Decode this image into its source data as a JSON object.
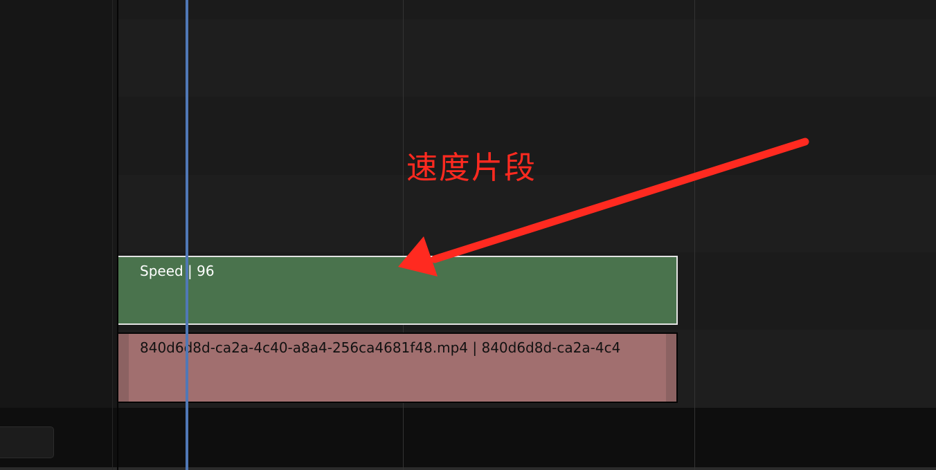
{
  "timeline": {
    "strips": {
      "speed": {
        "label": "Speed | 96",
        "color": "#4a734d",
        "selected": true
      },
      "movie": {
        "label": "840d6d8d-ca2a-4c40-a8a4-256ca4681f48.mp4 | 840d6d8d-ca2a-4c4",
        "color": "#a16f6f"
      }
    },
    "playhead_color": "#5078b6"
  },
  "annotation": {
    "text": "速度片段",
    "color": "#ff2a20",
    "arrow_icon": "arrow-icon"
  }
}
